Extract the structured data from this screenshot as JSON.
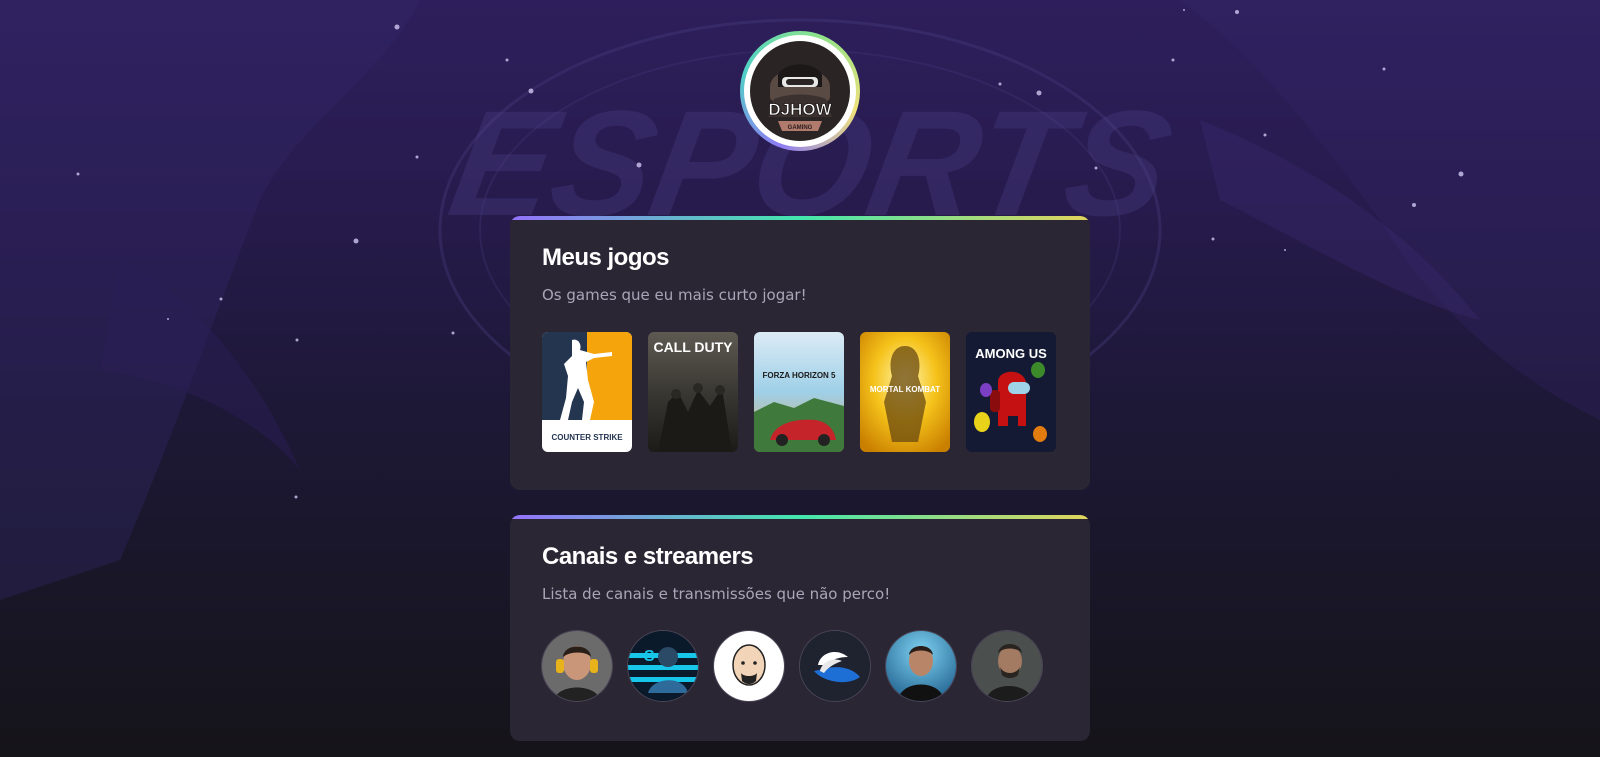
{
  "profile": {
    "logo_text": "DJHOW",
    "logo_subtext": "GAMING"
  },
  "background": {
    "watermark_text": "ESPORTS"
  },
  "games_section": {
    "title": "Meus jogos",
    "subtitle": "Os games que eu mais curto jogar!",
    "games": [
      {
        "name": "Counter Strike",
        "cover_text": "COUNTER STRIKE"
      },
      {
        "name": "Call of Duty",
        "cover_text": "CALL DUTY"
      },
      {
        "name": "Forza Horizon 5",
        "cover_text": "FORZA HORIZON 5"
      },
      {
        "name": "Mortal Kombat 11",
        "cover_text": "MORTAL KOMBAT"
      },
      {
        "name": "Among Us",
        "cover_text": "AMONG US"
      }
    ]
  },
  "channels_section": {
    "title": "Canais e streamers",
    "subtitle": "Lista de canais e transmissões que não perco!",
    "channels": [
      {
        "name": "channel-1"
      },
      {
        "name": "channel-2"
      },
      {
        "name": "channel-3"
      },
      {
        "name": "channel-4"
      },
      {
        "name": "channel-5"
      },
      {
        "name": "channel-6"
      }
    ]
  },
  "colors": {
    "accent_gradient": [
      "#9572fc",
      "#43e7ad",
      "#e2d45c"
    ],
    "card_bg": "#2a2634",
    "subtitle": "#a9a6b8"
  }
}
